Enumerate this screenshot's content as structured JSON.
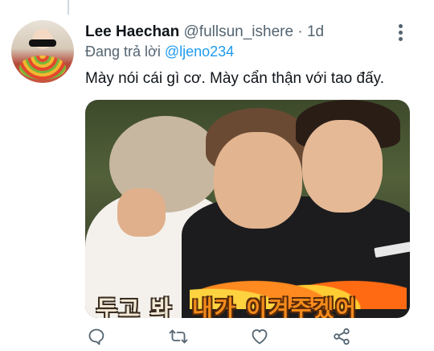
{
  "tweet": {
    "author_name": "Lee Haechan",
    "author_handle": "@fullsun_ishere",
    "separator": "·",
    "time": "1d",
    "replying_prefix": "Đang trả lời",
    "replying_to": "@ljeno234",
    "text": "Mày nói cái gì cơ. Mày cẩn thận với tao đấy.",
    "media_caption_part1": "두고 봐",
    "media_caption_part2": "내가 이겨주겠어"
  },
  "icons": {
    "more": "more-vertical-icon",
    "reply": "reply-icon",
    "retweet": "retweet-icon",
    "like": "heart-icon",
    "share": "share-icon"
  },
  "colors": {
    "link": "#1d9bf0",
    "secondary_text": "#536471",
    "primary_text": "#0f1419"
  }
}
